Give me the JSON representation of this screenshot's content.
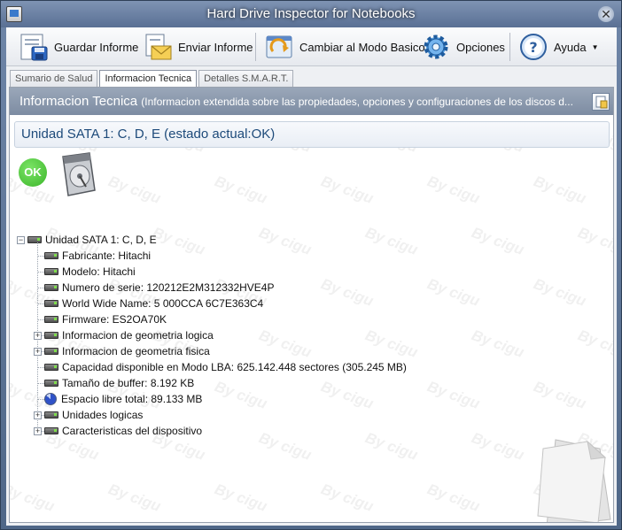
{
  "window": {
    "title": "Hard Drive Inspector for Notebooks"
  },
  "toolbar": {
    "save_report": "Guardar Informe",
    "send_report": "Enviar Informe",
    "basic_mode": "Cambiar al Modo Basico",
    "options": "Opciones",
    "help": "Ayuda"
  },
  "tabs": [
    {
      "label": "Sumario de Salud",
      "active": false
    },
    {
      "label": "Informacion Tecnica",
      "active": true
    },
    {
      "label": "Detalles S.M.A.R.T.",
      "active": false
    }
  ],
  "header": {
    "title": "Informacion Tecnica",
    "description": "(Informacion extendida sobre las propiedades, opciones y configuraciones de los discos d..."
  },
  "section": {
    "title": "Unidad SATA 1: C, D, E (estado actual:OK)"
  },
  "status": {
    "badge": "OK",
    "color": "#3cb52a"
  },
  "watermark": "By cigu",
  "tree": {
    "root": "Unidad SATA 1: C, D, E",
    "items": [
      {
        "label": "Fabricante: Hitachi",
        "expandable": false,
        "icon": "drive-icon"
      },
      {
        "label": "Modelo: Hitachi",
        "expandable": false,
        "icon": "drive-icon"
      },
      {
        "label": "Numero de serie: 120212E2M312332HVE4P",
        "expandable": false,
        "icon": "drive-icon"
      },
      {
        "label": "World Wide Name: 5 000CCA 6C7E363C4",
        "expandable": false,
        "icon": "drive-icon"
      },
      {
        "label": "Firmware: ES2OA70K",
        "expandable": false,
        "icon": "drive-icon"
      },
      {
        "label": "Informacion de geometria logica",
        "expandable": true,
        "icon": "drive-icon"
      },
      {
        "label": "Informacion de geometria fisica",
        "expandable": true,
        "icon": "drive-icon"
      },
      {
        "label": "Capacidad disponible en Modo LBA: 625.142.448 sectores (305.245 MB)",
        "expandable": false,
        "icon": "drive-icon"
      },
      {
        "label": "Tamaño de buffer: 8.192 KB",
        "expandable": false,
        "icon": "drive-icon"
      },
      {
        "label": "Espacio libre total: 89.133 MB",
        "expandable": false,
        "icon": "pie-chart-icon"
      },
      {
        "label": "Unidades logicas",
        "expandable": true,
        "icon": "drive-icon"
      },
      {
        "label": "Caracteristicas del dispositivo",
        "expandable": true,
        "icon": "drive-icon"
      }
    ]
  }
}
